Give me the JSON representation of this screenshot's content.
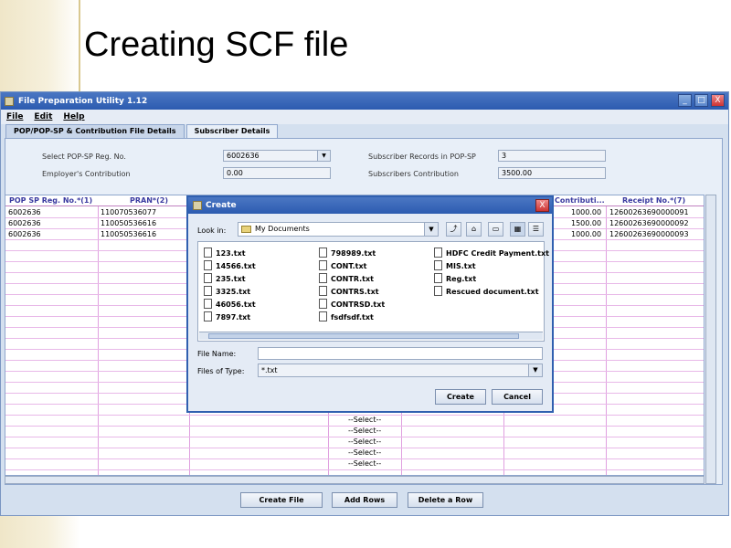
{
  "slide": {
    "title": "Creating SCF file"
  },
  "window": {
    "title": "File Preparation Utility 1.12",
    "controls": {
      "minimize": "_",
      "maximize": "□",
      "close": "X"
    }
  },
  "menu": [
    "File",
    "Edit",
    "Help"
  ],
  "tabs": [
    "POP/POP-SP & Contribution File Details",
    "Subscriber Details"
  ],
  "form": {
    "reg_no_label": "Select POP-SP Reg. No.",
    "reg_no_value": "6002636",
    "employer_label": "Employer's Contribution",
    "employer_value": "0.00",
    "records_label": "Subscriber Records in POP-SP",
    "records_value": "3",
    "subscriber_contrib_label": "Subscribers Contribution",
    "subscriber_contrib_value": "3500.00"
  },
  "table": {
    "headers": [
      "POP SP Reg. No.*(1)",
      "PRAN*(2)",
      "Contributi...",
      "Receipt No.*(7)"
    ],
    "rows": [
      [
        "6002636",
        "110070536077",
        "1000.00",
        "12600263690000091"
      ],
      [
        "6002636",
        "110050536616",
        "1500.00",
        "12600263690000092"
      ],
      [
        "6002636",
        "110050536616",
        "1000.00",
        "12600263690000093"
      ]
    ],
    "select_placeholder": "--Select--"
  },
  "buttons": {
    "create_file": "Create File",
    "add_rows": "Add Rows",
    "delete_row": "Delete a Row"
  },
  "dialog": {
    "title": "Create",
    "close": "X",
    "look_in_label": "Look in:",
    "look_in_value": "My Documents",
    "files": {
      "col1": [
        "123.txt",
        "14566.txt",
        "235.txt",
        "3325.txt",
        "46056.txt",
        "7897.txt"
      ],
      "col2": [
        "798989.txt",
        "CONT.txt",
        "CONTR.txt",
        "CONTRS.txt",
        "CONTRSD.txt",
        "fsdfsdf.txt"
      ],
      "col3": [
        "HDFC Credit Payment.txt",
        "MIS.txt",
        "Reg.txt",
        "Rescued document.txt"
      ]
    },
    "file_name_label": "File Name:",
    "file_name_value": "",
    "file_type_label": "Files of Type:",
    "file_type_value": "*.txt",
    "create_label": "Create",
    "cancel_label": "Cancel"
  }
}
